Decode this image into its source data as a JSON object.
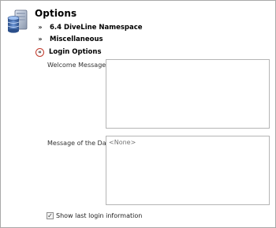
{
  "header": {
    "title": "Options",
    "icon": "database-server-icon"
  },
  "sections": [
    {
      "label": "6.4 DiveLine Namespace",
      "state": "collapsed"
    },
    {
      "label": "Miscellaneous",
      "state": "collapsed"
    },
    {
      "label": "Login Options",
      "state": "expanded"
    }
  ],
  "login_options": {
    "welcome_message": {
      "label": "Welcome Message",
      "value": "",
      "placeholder": ""
    },
    "message_of_day": {
      "label": "Message of the Day",
      "value": "",
      "placeholder": "<None>"
    },
    "show_last_login": {
      "label": "Show last login information",
      "checked": true
    }
  },
  "colors": {
    "highlight_circle": "#c0392b",
    "border": "#b5b5b5"
  }
}
